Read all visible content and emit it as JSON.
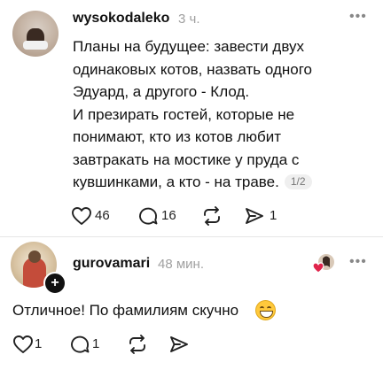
{
  "posts": [
    {
      "username": "wysokodaleko",
      "time": "3 ч.",
      "text_lines": [
        "Планы на будущее: завести двух",
        "одинаковых котов, назвать одного",
        "Эдуард, а другого - Клод.",
        "И презирать гостей, которые не",
        "понимают, кто из котов любит",
        "завтракать на мостике у пруда с",
        "кувшинками, а кто - на траве."
      ],
      "page_indicator": "1/2",
      "likes": "46",
      "replies": "16",
      "shares": "1",
      "more_label": "•••"
    },
    {
      "username": "gurovamari",
      "time": "48 мин.",
      "text": "Отличное! По фамилиям скучно",
      "likes": "1",
      "replies": "1",
      "follow_icon": "+",
      "more_label": "•••"
    }
  ],
  "colors": {
    "text": "#111111",
    "muted": "#a0a0a0",
    "heart_red": "#e0244b"
  }
}
